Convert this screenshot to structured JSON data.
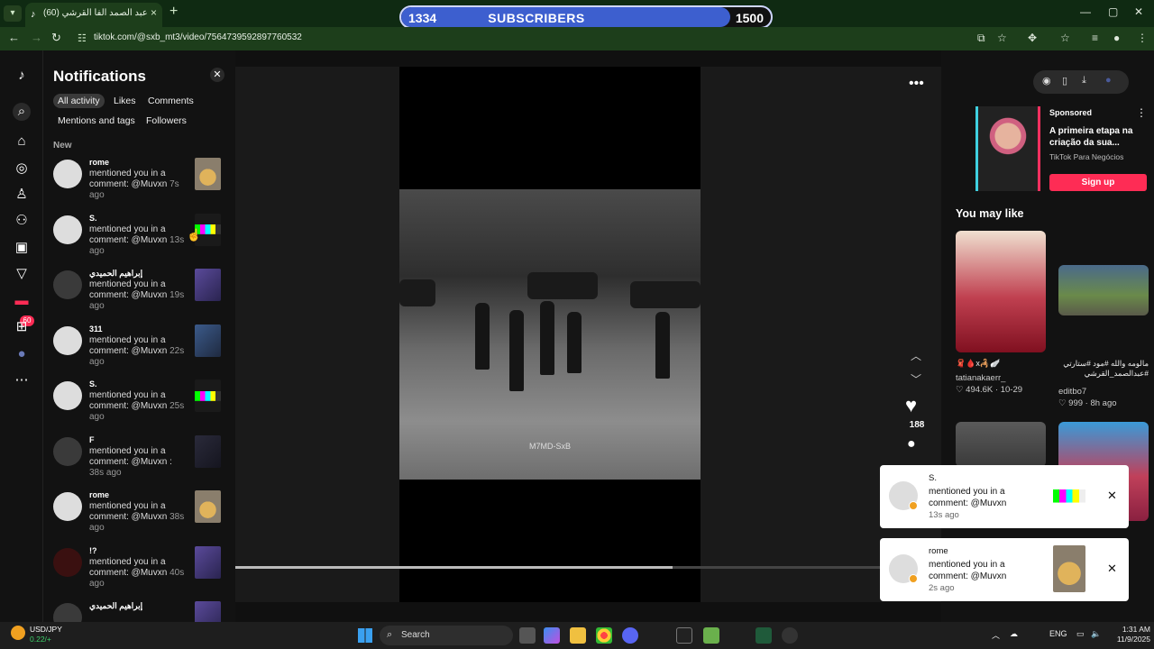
{
  "browser": {
    "tab_title": "عبد الصمد الفا القرشي (60)",
    "new_tab": "+",
    "url": "tiktok.com/@sxb_mt3/video/7564739592897760532",
    "window_controls": {
      "minimize": "—",
      "maximize": "▢",
      "close": "✕"
    }
  },
  "subscriber_bar": {
    "current": "1334",
    "label": "SUBSCRIBERS",
    "goal": "1500",
    "progress": 0.89,
    "color": "#3d5fcf"
  },
  "rail": {
    "icons": [
      "tiktok-logo",
      "search-icon",
      "home-icon",
      "explore-icon",
      "following-icon",
      "friends-icon",
      "live-icon",
      "activity-icon",
      "messages-icon",
      "upload-icon",
      "profile-icon",
      "more-icon"
    ],
    "activity_badge": "60"
  },
  "notifications": {
    "title": "Notifications",
    "filters": [
      "All activity",
      "Likes",
      "Comments",
      "Mentions and tags",
      "Followers"
    ],
    "section_label": "New",
    "items": [
      {
        "name": "rome",
        "message": "mentioned you in a comment: @Muvxn",
        "time": "7s",
        "suffix": "ago",
        "thumb": "soup",
        "avatar": "light"
      },
      {
        "name": "S.",
        "message": "mentioned you in a comment: @Muvxn",
        "time": "13s",
        "suffix": "ago",
        "thumb": "bars",
        "avatar": "light"
      },
      {
        "name": "إبراهيم الحميدي",
        "message": "mentioned you in a comment: @Muvxn",
        "time": "19s",
        "suffix": "ago",
        "thumb": "purple",
        "avatar": "dark"
      },
      {
        "name": "311",
        "message": "mentioned you in a comment: @Muvxn",
        "time": "22s",
        "suffix": "ago",
        "thumb": "blue",
        "avatar": "light"
      },
      {
        "name": "S.",
        "message": "mentioned you in a comment: @Muvxn",
        "time": "25s",
        "suffix": "ago",
        "thumb": "bars",
        "avatar": "light"
      },
      {
        "name": "F",
        "message": "mentioned you in a comment: @Muvxn :",
        "time": "38s",
        "suffix": "ago",
        "thumb": "dim",
        "avatar": "dark"
      },
      {
        "name": "rome",
        "message": "mentioned you in a comment: @Muvxn",
        "time": "38s",
        "suffix": "ago",
        "thumb": "soup",
        "avatar": "light"
      },
      {
        "name": "!?",
        "message": "mentioned you in a comment: @Muvxn",
        "time": "40s",
        "suffix": "ago",
        "thumb": "purple",
        "avatar": "red"
      },
      {
        "name": "إبراهيم الحميدي",
        "message": "",
        "time": "",
        "suffix": "",
        "thumb": "purple",
        "avatar": "dark"
      }
    ]
  },
  "video": {
    "watermark": "M7MD-SxB",
    "likes": "188",
    "progress": 0.62
  },
  "sidebar_right": {
    "ad": {
      "label": "Sponsored",
      "title": "A primeira etapa na criação da sua...",
      "advertiser": "TikTok Para Negócios",
      "cta": "Sign up"
    },
    "you_may_like": "You may like",
    "cards": [
      {
        "title": "🧣🩸x🦂🪽",
        "author": "tatianakaerr_",
        "stats": "♡ 494.6K · 10-29"
      },
      {
        "title": "مالومه والله #مود #ستارتي #عبدالصمد_القرشي",
        "author": "editbo7",
        "stats": "♡ 999 · 8h ago"
      }
    ]
  },
  "toasts": [
    {
      "name": "S.",
      "message": "mentioned you in a comment: @Muvxn",
      "time": "13s ago"
    },
    {
      "name": "rome",
      "message": "mentioned you in a comment: @Muvxn",
      "time": "2s ago"
    }
  ],
  "taskbar": {
    "ticker_pair": "USD/JPY",
    "ticker_change": "0.22/+",
    "search": "Search",
    "lang": "ENG",
    "time": "1:31 AM",
    "date": "11/9/2025"
  }
}
